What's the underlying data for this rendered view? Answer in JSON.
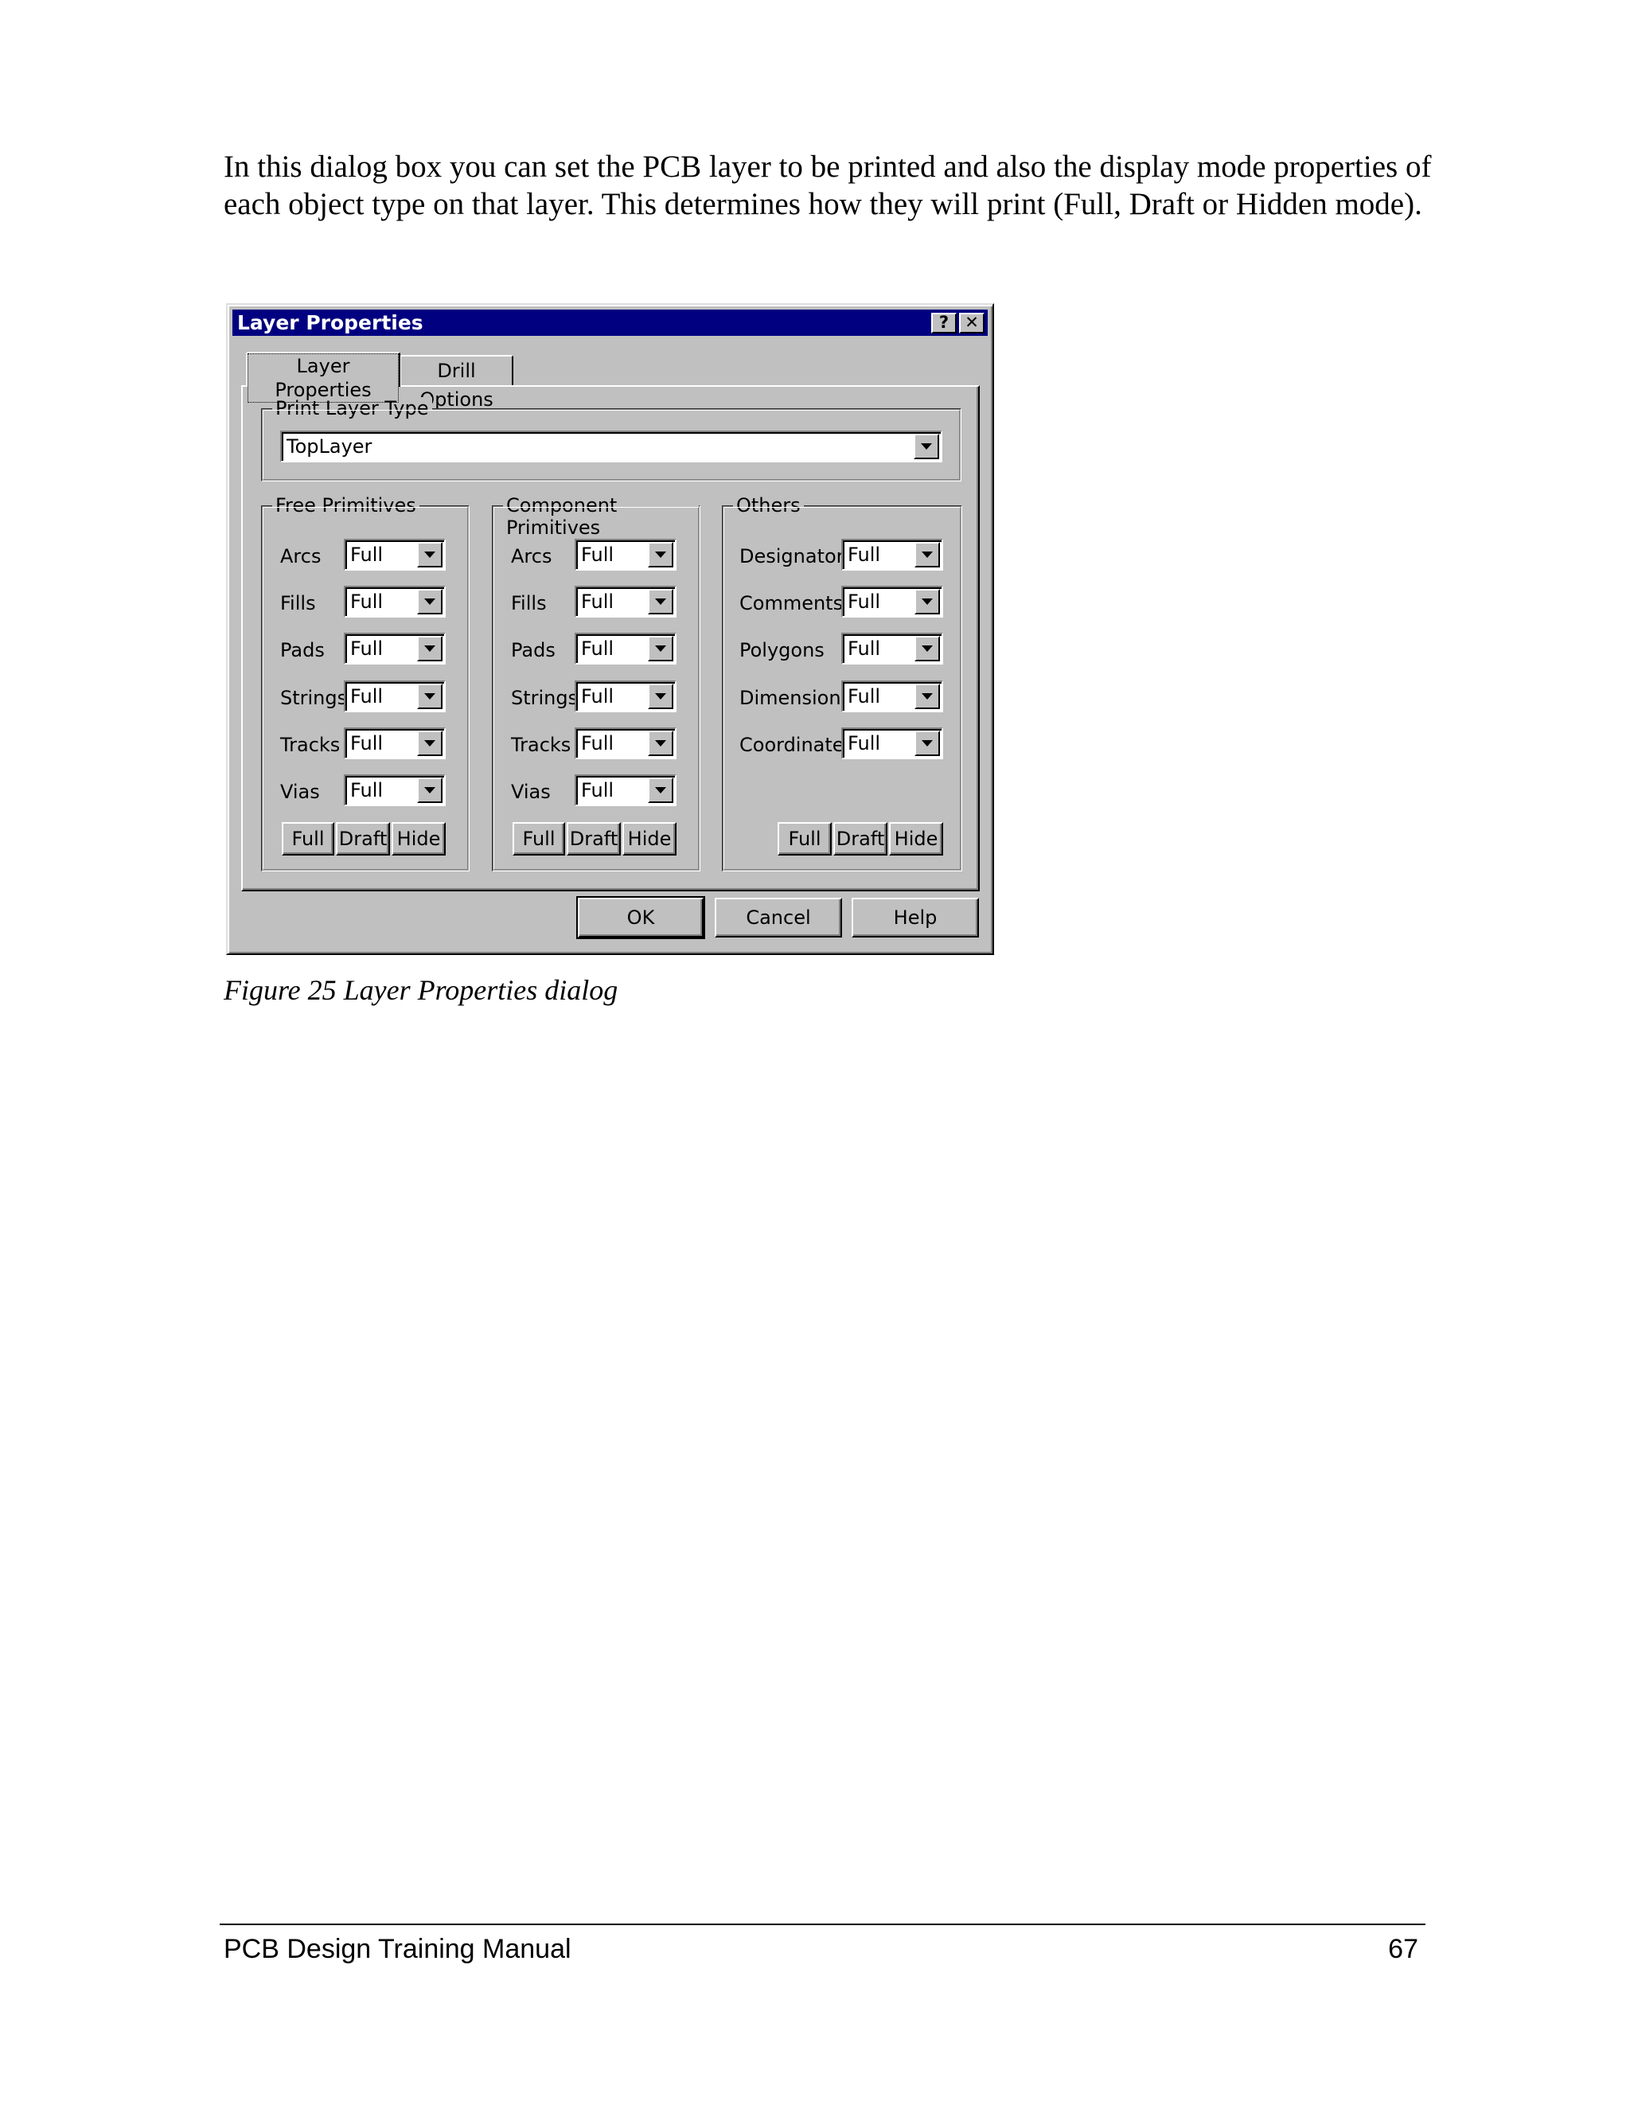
{
  "intro_text": "In this dialog box you can set the PCB layer to be printed and also the display mode properties of each object type on that layer. This determines how they will print (Full, Draft or Hidden mode).",
  "dialog": {
    "title": "Layer Properties",
    "help_glyph": "?",
    "close_glyph": "✕",
    "tabs": [
      "Layer Properties",
      "Drill Options"
    ],
    "print_layer_group": "Print Layer Type",
    "print_layer_value": "TopLayer",
    "groups": {
      "free": {
        "title": "Free Primitives",
        "rows": [
          {
            "label": "Arcs",
            "value": "Full"
          },
          {
            "label": "Fills",
            "value": "Full"
          },
          {
            "label": "Pads",
            "value": "Full"
          },
          {
            "label": "Strings",
            "value": "Full"
          },
          {
            "label": "Tracks",
            "value": "Full"
          },
          {
            "label": "Vias",
            "value": "Full"
          }
        ]
      },
      "component": {
        "title": "Component Primitives",
        "rows": [
          {
            "label": "Arcs",
            "value": "Full"
          },
          {
            "label": "Fills",
            "value": "Full"
          },
          {
            "label": "Pads",
            "value": "Full"
          },
          {
            "label": "Strings",
            "value": "Full"
          },
          {
            "label": "Tracks",
            "value": "Full"
          },
          {
            "label": "Vias",
            "value": "Full"
          }
        ]
      },
      "others": {
        "title": "Others",
        "rows": [
          {
            "label": "Designators",
            "value": "Full"
          },
          {
            "label": "Comments",
            "value": "Full"
          },
          {
            "label": "Polygons",
            "value": "Full"
          },
          {
            "label": "Dimensions",
            "value": "Full"
          },
          {
            "label": "Coordinates",
            "value": "Full"
          }
        ]
      }
    },
    "mode_buttons": [
      "Full",
      "Draft",
      "Hide"
    ],
    "ok": "OK",
    "cancel": "Cancel",
    "help": "Help"
  },
  "caption": "Figure 25 Layer Properties dialog",
  "footer": {
    "title": "PCB Design Training Manual",
    "page_number": "67"
  }
}
